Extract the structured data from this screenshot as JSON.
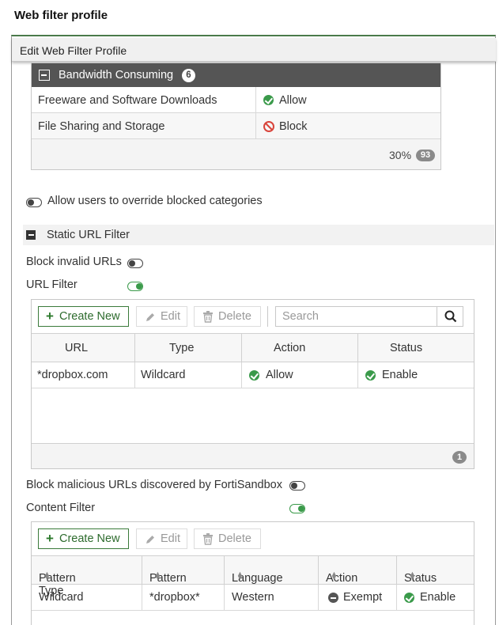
{
  "caption": "Web filter profile",
  "window": {
    "title": "Edit Web Filter Profile"
  },
  "category_group": {
    "label": "Bandwidth Consuming",
    "count": "6",
    "rows": [
      {
        "category": "Freeware and Software Downloads",
        "action": "Allow",
        "action_icon": "check-circle-icon"
      },
      {
        "category": "File Sharing and Storage",
        "action": "Block",
        "action_icon": "block-icon"
      }
    ],
    "footer_percent": "30%",
    "footer_count": "93"
  },
  "override": {
    "label": "Allow users to override blocked categories",
    "enabled": false
  },
  "static_url_filter": {
    "section_label": "Static URL Filter",
    "block_invalid_urls": {
      "label": "Block invalid URLs",
      "enabled": false
    },
    "url_filter": {
      "label": "URL Filter",
      "enabled": true
    },
    "toolbar": {
      "create_new": "Create New",
      "edit": "Edit",
      "delete": "Delete",
      "search_placeholder": "Search"
    },
    "columns": [
      "URL",
      "Type",
      "Action",
      "Status"
    ],
    "rows": [
      {
        "url": "*dropbox.com",
        "type": "Wildcard",
        "action": "Allow",
        "status": "Enable"
      }
    ],
    "footer_count": "1"
  },
  "block_malicious": {
    "label": "Block malicious URLs discovered by FortiSandbox",
    "enabled": false
  },
  "content_filter": {
    "label": "Content Filter",
    "enabled": true,
    "toolbar": {
      "create_new": "Create New",
      "edit": "Edit",
      "delete": "Delete"
    },
    "columns": [
      "Pattern Type",
      "Pattern",
      "Language",
      "Action",
      "Status"
    ],
    "rows": [
      {
        "pattern_type": "Wildcard",
        "pattern": "*dropbox*",
        "language": "Western",
        "action": "Exempt",
        "status": "Enable"
      }
    ]
  },
  "colors": {
    "accent_green": "#3a9a4a",
    "block_red": "#d9443b",
    "group_header": "#555555"
  }
}
